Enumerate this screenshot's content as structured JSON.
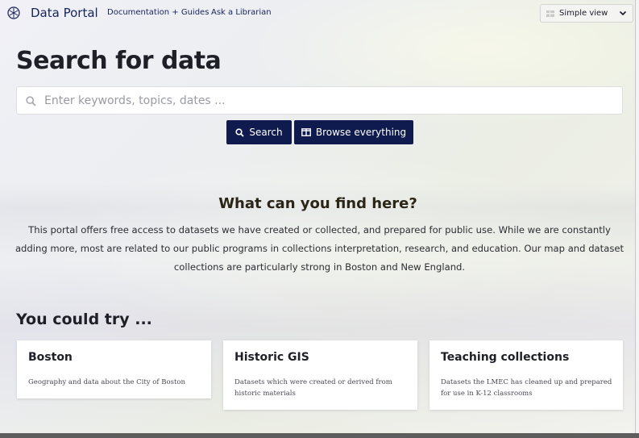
{
  "nav": {
    "brand": "Data Portal",
    "links": [
      "Documentation + Guides",
      "Ask a Librarian"
    ],
    "view_select": {
      "value": "Simple view"
    }
  },
  "page_title": "Search for data",
  "search": {
    "placeholder": "Enter keywords, topics, dates ...",
    "value": "",
    "search_label": "Search",
    "browse_label": "Browse everything"
  },
  "about": {
    "title": "What can you find here?",
    "body": "This portal offers free access to datasets we have created or collected, and prepared for public use. While we are constantly adding more, most are related to our public programs in collections interpretation, research, and education. Our map and dataset collections are particularly strong in Boston and New England."
  },
  "try": {
    "title": "You could try ...",
    "cards": [
      {
        "title": "Boston",
        "desc": "Geography and data about the City of Boston"
      },
      {
        "title": "Historic GIS",
        "desc": "Datasets which were created or derived from historic materials"
      },
      {
        "title": "Teaching collections",
        "desc": "Datasets the LMEC has cleaned up and prepared for use in K-12 classrooms"
      }
    ]
  },
  "colors": {
    "brand_navy": "#0f1b4f",
    "link_navy": "#16245c",
    "heading": "#1f1f28"
  }
}
